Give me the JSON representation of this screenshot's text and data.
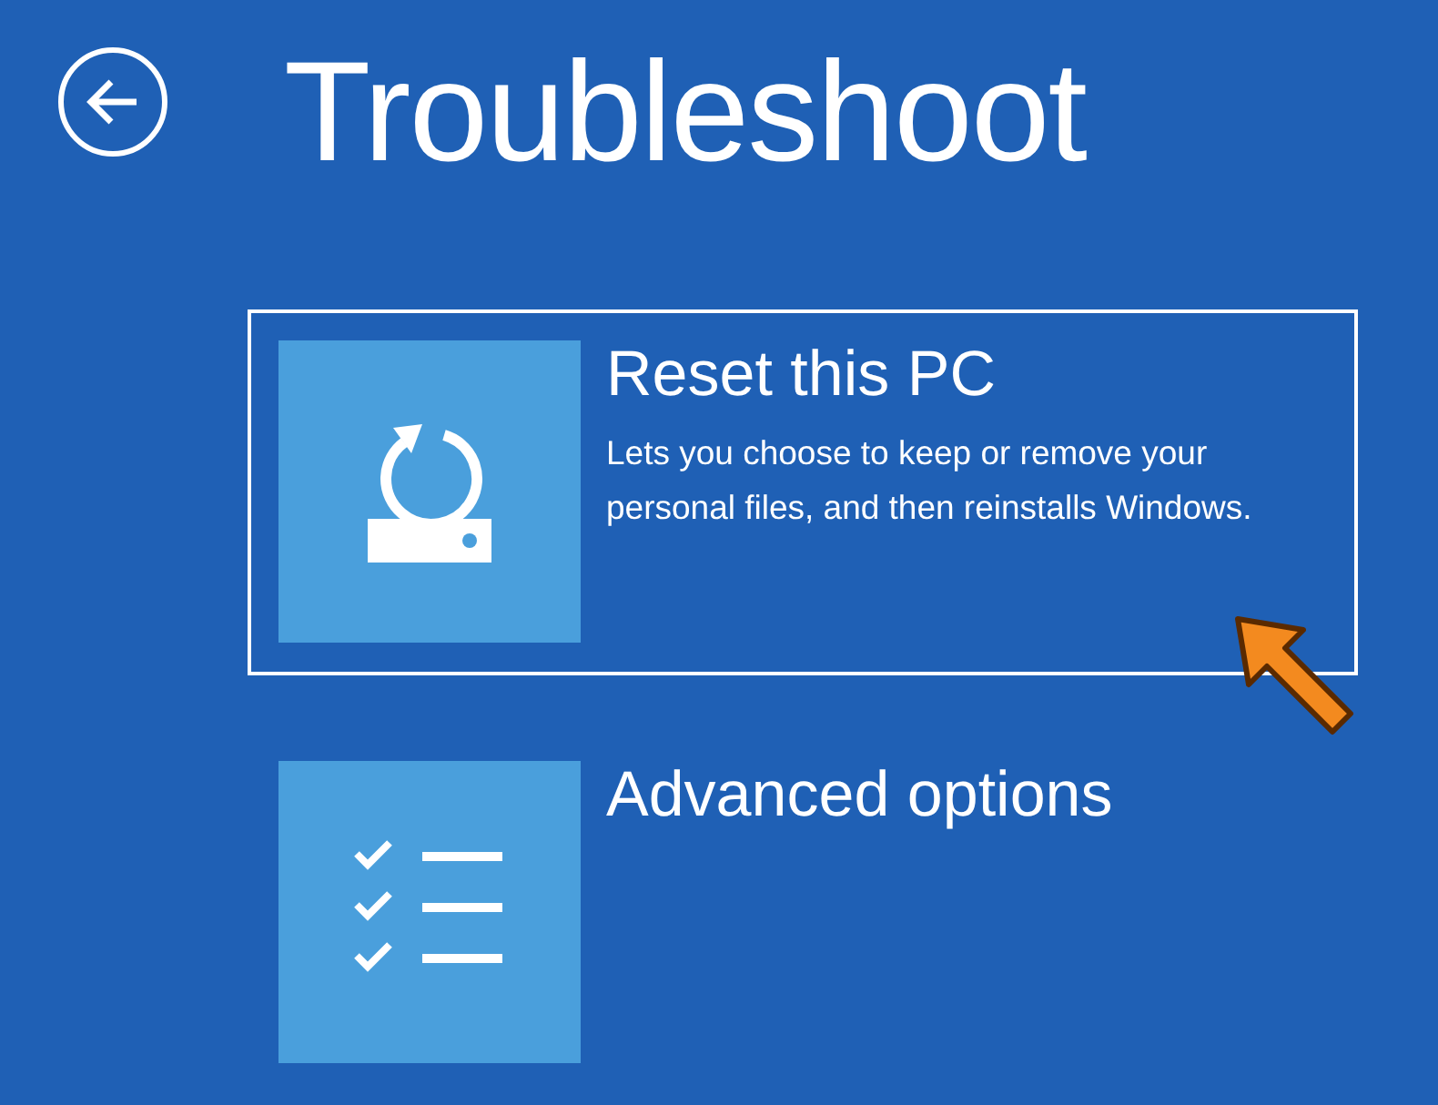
{
  "header": {
    "title": "Troubleshoot"
  },
  "options": [
    {
      "kind": "reset",
      "title": "Reset this PC",
      "description": "Lets you choose to keep or remove your personal files, and then reinstalls Windows.",
      "selected": true
    },
    {
      "kind": "checklist",
      "title": "Advanced options",
      "selected": false
    }
  ]
}
